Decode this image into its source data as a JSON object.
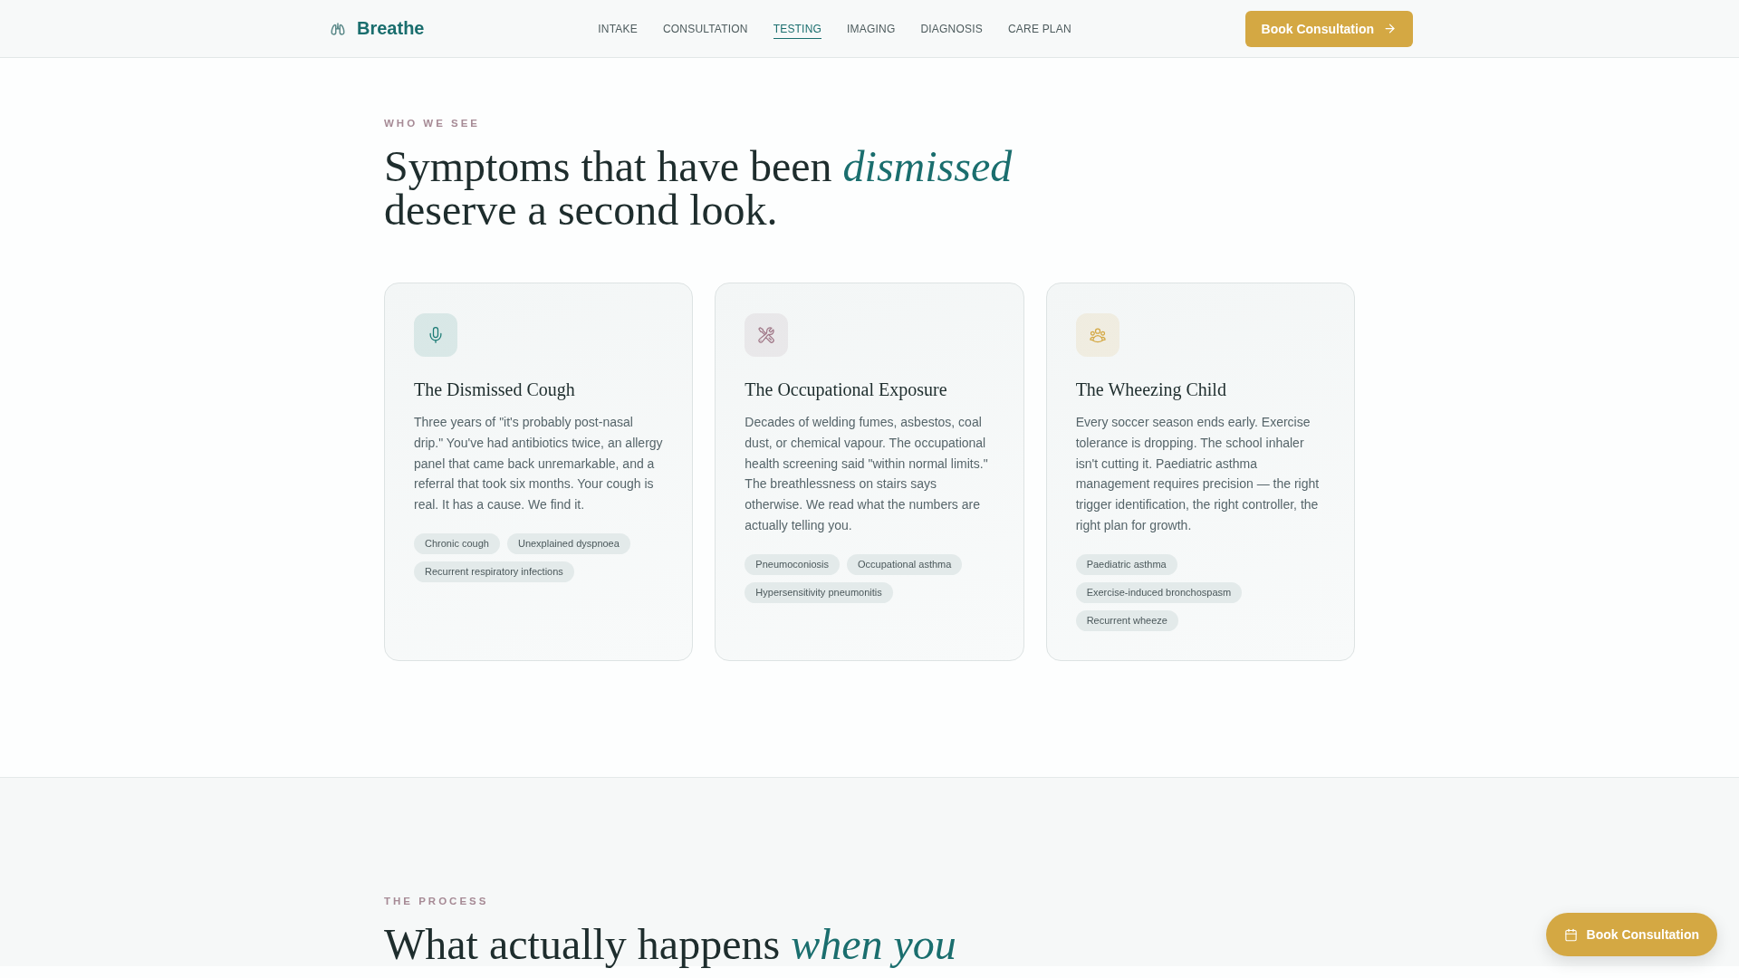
{
  "header": {
    "logo": "Breathe",
    "nav": [
      {
        "label": "INTAKE",
        "selected": false
      },
      {
        "label": "CONSULTATION",
        "selected": false
      },
      {
        "label": "TESTING",
        "selected": true
      },
      {
        "label": "IMAGING",
        "selected": false
      },
      {
        "label": "DIAGNOSIS",
        "selected": false
      },
      {
        "label": "CARE PLAN",
        "selected": false
      }
    ],
    "cta": "Book Consultation"
  },
  "who_we_see": {
    "eyebrow": "WHO WE SEE",
    "heading": "Symptoms that have been *dismissed* deserve a second look.",
    "cards": [
      {
        "title": "The Dismissed Cough",
        "body": "Three years of \"it's probably post-nasal drip.\" You've had antibiotics twice, an allergy panel that came back unremarkable, and a referral that took six months. Your cough is real. It has a cause. We find it.",
        "color": "#1a7a74",
        "tags": [
          "Chronic cough",
          "Unexplained dyspnoea",
          "Recurrent respiratory infections"
        ]
      },
      {
        "title": "The Occupational Exposure",
        "body": "Decades of welding fumes, asbestos, coal dust, or chemical vapour. The occupational health screening said \"within normal limits.\" The breathlessness on stairs says otherwise. We read what the numbers are actually telling you.",
        "color": "#a07888",
        "tags": [
          "Pneumoconiosis",
          "Occupational asthma",
          "Hypersensitivity pneumonitis"
        ]
      },
      {
        "title": "The Wheezing Child",
        "body": "Every soccer season ends early. Exercise tolerance is dropping. The school inhaler isn't cutting it. Paediatric asthma management requires precision — the right trigger identification, the right controller, the right plan for growth.",
        "color": "#d4a843",
        "tags": [
          "Paediatric asthma",
          "Exercise-induced bronchospasm",
          "Recurrent wheeze"
        ]
      }
    ]
  },
  "process": {
    "eyebrow": "THE PROCESS",
    "heading": "What actually happens *when you*"
  },
  "floating_button": "Book Consultation"
}
